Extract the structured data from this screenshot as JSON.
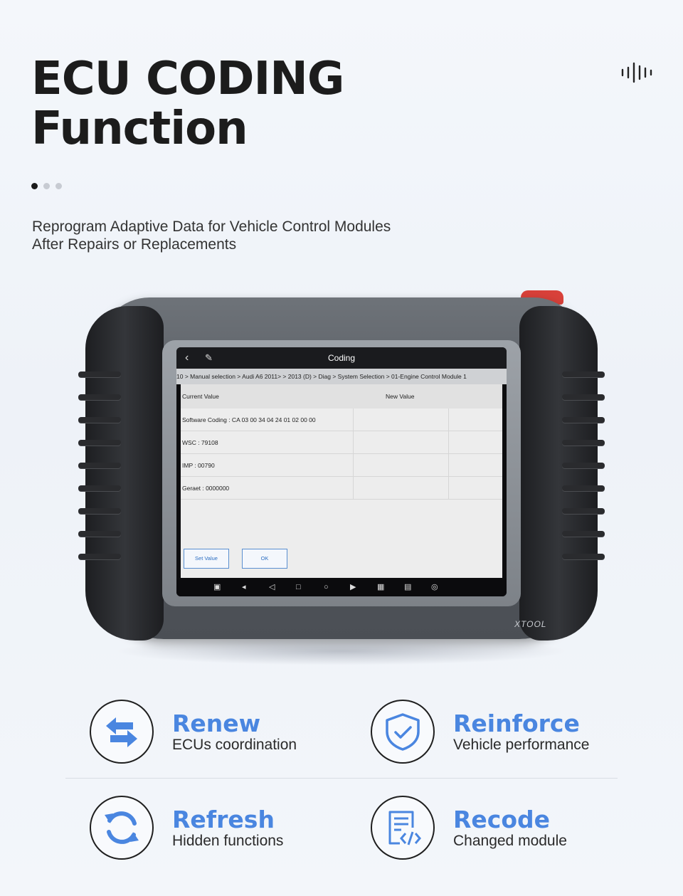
{
  "header": {
    "title_line1": "ECU CODING",
    "title_line2": "Function",
    "subtitle_line1": "Reprogram Adaptive Data for Vehicle Control Modules",
    "subtitle_line2": "After Repairs or Replacements"
  },
  "carousel": {
    "count": 3,
    "active": 1
  },
  "device": {
    "brand": "XTOOL",
    "screen": {
      "title": "Coding",
      "breadcrumb": "10 > Manual selection > Audi A6 2011> > 2013 (D) > Diag > System Selection > 01-Engine Control Module 1",
      "columns": {
        "current": "Current Value",
        "new": "New Value"
      },
      "rows": [
        "Software Coding : CA 03 00 34 04 24 01 02 00 00",
        "WSC : 79108",
        "IMP : 00790",
        "Geraet : 0000000"
      ],
      "buttons": {
        "set_value": "Set Value",
        "ok": "OK"
      }
    }
  },
  "features": [
    {
      "title": "Renew",
      "desc": "ECUs coordination",
      "icon": "swap-arrows-icon"
    },
    {
      "title": "Reinforce",
      "desc": "Vehicle performance",
      "icon": "shield-check-icon"
    },
    {
      "title": "Refresh",
      "desc": "Hidden functions",
      "icon": "refresh-icon"
    },
    {
      "title": "Recode",
      "desc": "Changed module",
      "icon": "code-document-icon"
    }
  ],
  "colors": {
    "accent": "#4a86e0",
    "title": "#1c1c1c",
    "warning_button": "#d8413a"
  }
}
